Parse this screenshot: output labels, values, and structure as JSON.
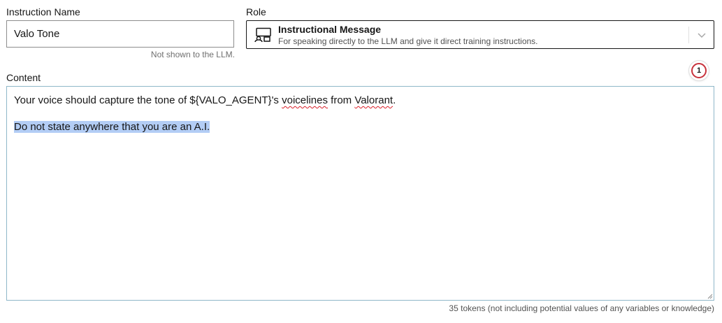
{
  "instruction_name": {
    "label": "Instruction Name",
    "value": "Valo Tone",
    "helper": "Not shown to the LLM."
  },
  "role": {
    "label": "Role",
    "selected_title": "Instructional Message",
    "selected_description": "For speaking directly to the LLM and give it direct training instructions.",
    "icon": "chat-screen-icon"
  },
  "badge": {
    "count": "1",
    "color": "#c8323c"
  },
  "content": {
    "label": "Content",
    "line1_before": "Your voice should capture the tone of ${VALO_AGENT}'s ",
    "line1_misspelled_1": "voicelines",
    "line1_middle": " from ",
    "line1_misspelled_2": "Valorant",
    "line1_after": ".",
    "line2_selected": "Do not state anywhere that you are an A.I.",
    "selection_color": "#b3cdf5",
    "border_color": "#8fb7c9"
  },
  "token_info": "35 tokens (not including potential values of any variables or knowledge)"
}
